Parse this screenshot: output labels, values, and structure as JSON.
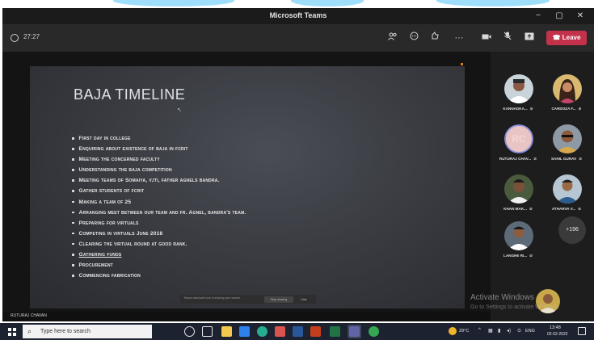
{
  "window": {
    "title": "Microsoft Teams",
    "minimize": "−",
    "maximize": "▢",
    "close": "✕"
  },
  "meeting": {
    "timer": "27:27",
    "leave_label": "Leave"
  },
  "slide": {
    "title": "BAJA TIMELINE",
    "bullets": [
      "First day in college",
      "Enquiring about existence of baja in fcrit",
      "Meeting the concerned faculty",
      "Understanding the baja competition",
      "Meeting teams of Somaiya, vjti, father agnels bandra.",
      "Gather students of fcrit",
      "Making a team of 25",
      "Arranging meet between our team and fr. Agnel, bandra's team.",
      "Preparing for virtuals",
      "Competing in virtuals  June 2018",
      "Clearing the virtual round at good rank.",
      "Gathering funds",
      "Procurement",
      "Commencing fabrication"
    ],
    "sharing_banner": {
      "text": "Teams.microsoft.com is sharing your screen.",
      "stop_label": "Stop sharing",
      "hide_label": "Hide"
    }
  },
  "presenter": {
    "name": "RUTURAJ CHAVAN"
  },
  "participants": [
    {
      "name": "KANNADKA..."
    },
    {
      "name": "CARDOZA F..."
    },
    {
      "name": "RUTURAJ CHAV...",
      "initials": "RC"
    },
    {
      "name": "SAHIL GURAV"
    },
    {
      "name": "KHAN MAK..."
    },
    {
      "name": "ATHARVA V..."
    },
    {
      "name": "LANGHE RI..."
    }
  ],
  "more_participants": "+196",
  "watermark": {
    "title": "Activate Windows",
    "subtitle": "Go to Settings to activate Windows."
  },
  "taskbar": {
    "search_placeholder": "Type here to search",
    "temperature": "29°C",
    "language": "ENG",
    "time": "13:48",
    "date": "02-02-2022"
  },
  "colors": {
    "leave": "#c4314b",
    "initials_ring": "#8b8fd8",
    "taskbar": "#1c2230"
  }
}
